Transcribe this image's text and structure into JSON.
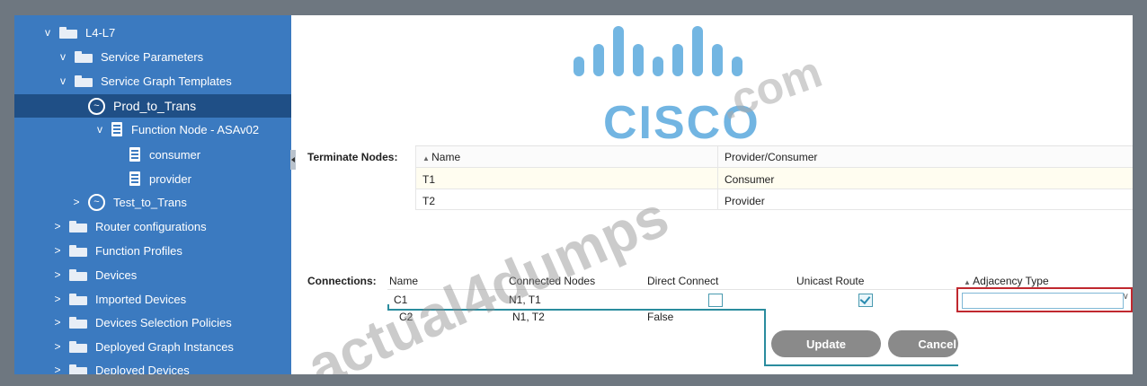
{
  "sidebar": {
    "items": [
      {
        "label": "L4-L7",
        "chevron": "v",
        "icon": "folder-icon"
      },
      {
        "label": "Service Parameters",
        "chevron": "v",
        "icon": "folder-icon"
      },
      {
        "label": "Service Graph Templates",
        "chevron": "v",
        "icon": "folder-icon"
      },
      {
        "label": "Prod_to_Trans",
        "chevron": "",
        "icon": "graph-icon",
        "selected": true
      },
      {
        "label": "Function Node - ASAv02",
        "chevron": "v",
        "icon": "document-icon"
      },
      {
        "label": "consumer",
        "chevron": "",
        "icon": "document-icon"
      },
      {
        "label": "provider",
        "chevron": "",
        "icon": "document-icon"
      },
      {
        "label": "Test_to_Trans",
        "chevron": ">",
        "icon": "graph-icon"
      },
      {
        "label": "Router configurations",
        "chevron": ">",
        "icon": "folder-icon"
      },
      {
        "label": "Function Profiles",
        "chevron": ">",
        "icon": "folder-icon"
      },
      {
        "label": "Devices",
        "chevron": ">",
        "icon": "folder-icon"
      },
      {
        "label": "Imported Devices",
        "chevron": ">",
        "icon": "folder-icon"
      },
      {
        "label": "Devices Selection Policies",
        "chevron": ">",
        "icon": "folder-icon"
      },
      {
        "label": "Deployed Graph Instances",
        "chevron": ">",
        "icon": "folder-icon"
      },
      {
        "label": "Deployed Devices",
        "chevron": ">",
        "icon": "folder-icon"
      }
    ]
  },
  "terminate_nodes": {
    "label": "Terminate Nodes:",
    "columns": [
      "Name",
      "Provider/Consumer"
    ],
    "rows": [
      {
        "name": "T1",
        "role": "Consumer"
      },
      {
        "name": "T2",
        "role": "Provider"
      }
    ]
  },
  "connections": {
    "label": "Connections:",
    "columns": [
      "Name",
      "Connected Nodes",
      "Direct Connect",
      "Unicast Route",
      "Adjacency Type"
    ],
    "rows": [
      {
        "name": "C1",
        "nodes": "N1, T1",
        "direct_connect_checked": false,
        "unicast_route_checked": true,
        "adjacency_type": ""
      },
      {
        "name": "C2",
        "nodes": "N1, T2",
        "direct_connect": "False"
      }
    ]
  },
  "buttons": {
    "update": "Update",
    "cancel": "Cancel"
  },
  "watermark": {
    "brand": "CISCO",
    "suffix": ".com",
    "diagonal": "actual4dumps"
  },
  "colors": {
    "sidebar_bg": "#3b7ac0",
    "sidebar_selected": "#1f4f86",
    "highlight_border": "#c0282f",
    "teal_outline": "#2a8c9e",
    "button_gray": "#8a8a8a"
  }
}
